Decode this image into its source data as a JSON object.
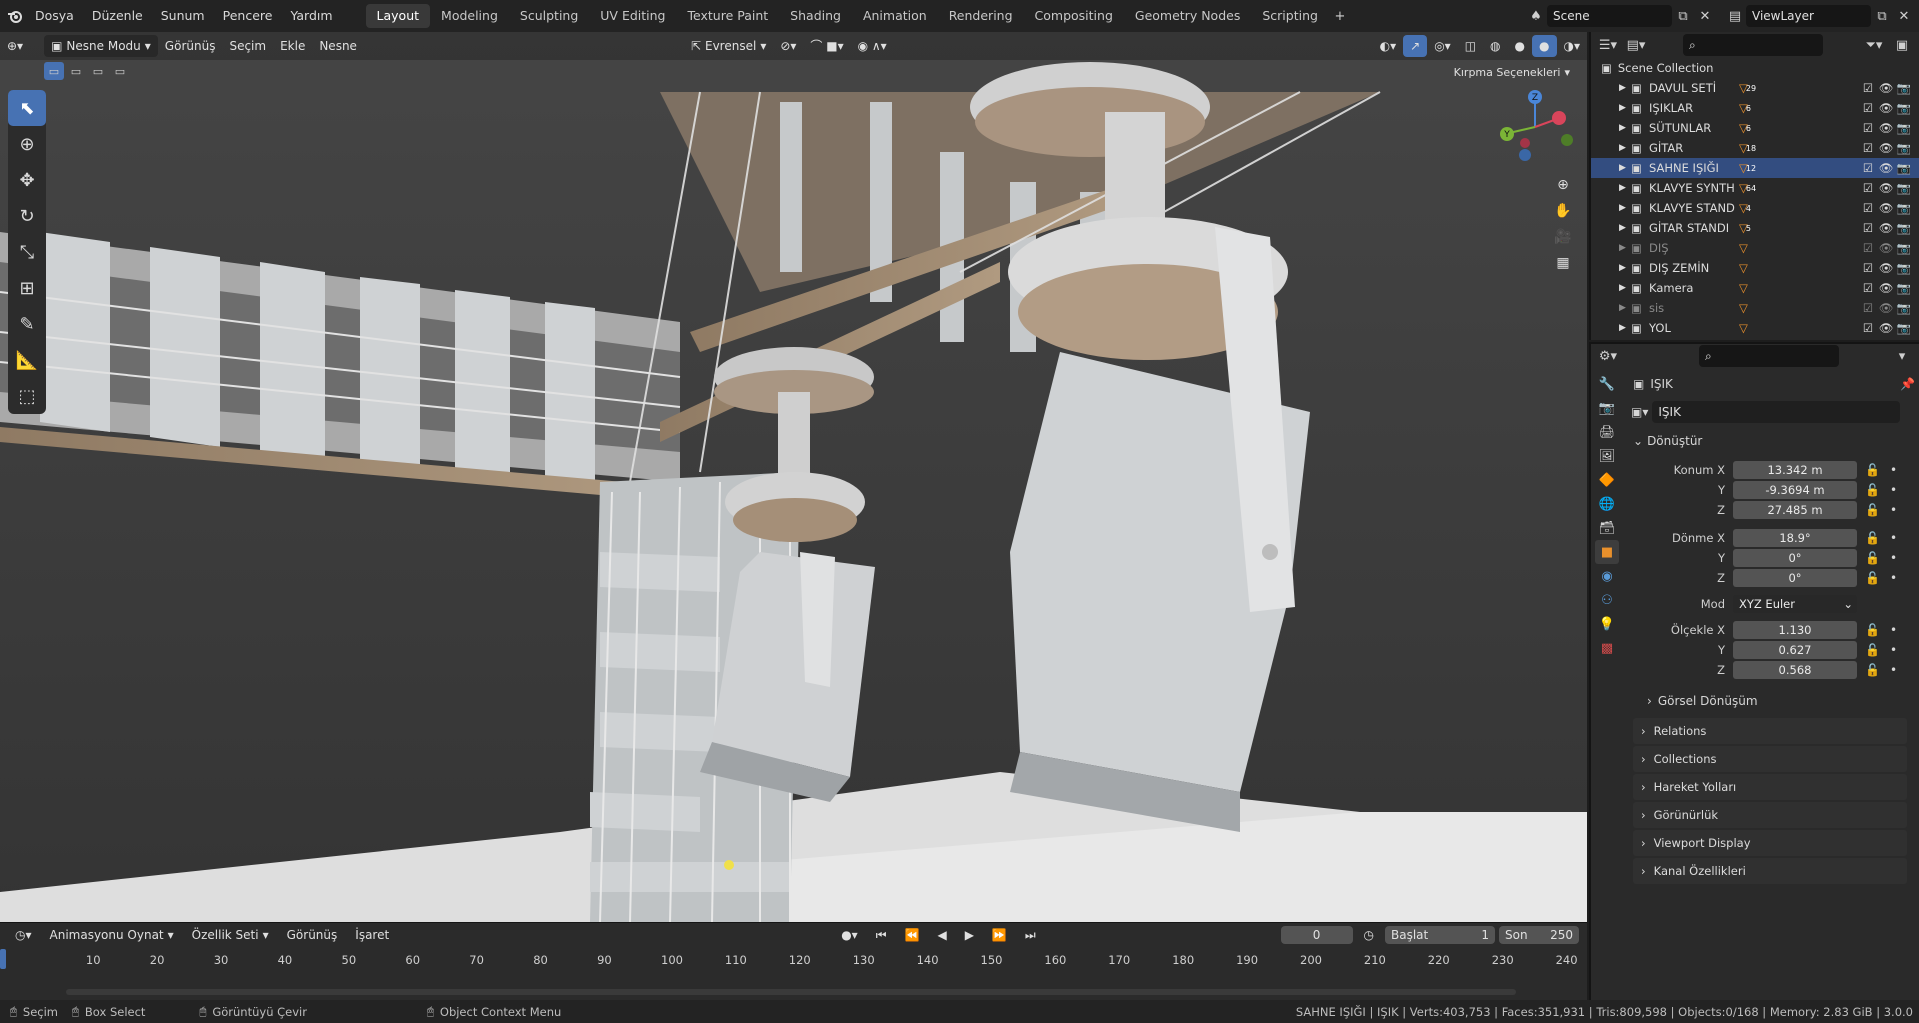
{
  "topbar": {
    "menus": [
      "Dosya",
      "Düzenle",
      "Sunum",
      "Pencere",
      "Yardım"
    ],
    "workspaces": [
      "Layout",
      "Modeling",
      "Sculpting",
      "UV Editing",
      "Texture Paint",
      "Shading",
      "Animation",
      "Rendering",
      "Compositing",
      "Geometry Nodes",
      "Scripting"
    ],
    "active_workspace": "Layout",
    "scene": "Scene",
    "view_layer": "ViewLayer"
  },
  "viewport": {
    "mode": "Nesne Modu",
    "menus": [
      "Görünüş",
      "Seçim",
      "Ekle",
      "Nesne"
    ],
    "transform_orientation": "Evrensel",
    "options_label": "Kırpma Seçenekleri"
  },
  "outliner": {
    "root": "Scene Collection",
    "items": [
      {
        "label": "DAVUL SETİ",
        "badge": "29",
        "dim": false,
        "selected": false
      },
      {
        "label": "IŞIKLAR",
        "badge": "6",
        "dim": false,
        "selected": false
      },
      {
        "label": "SÜTUNLAR",
        "badge": "6",
        "dim": false,
        "selected": false
      },
      {
        "label": "GİTAR",
        "badge": "18",
        "dim": false,
        "selected": false
      },
      {
        "label": "SAHNE IŞIĞI",
        "badge": "12",
        "dim": false,
        "selected": true
      },
      {
        "label": "KLAVYE SYNTH",
        "badge": "64",
        "dim": false,
        "selected": false
      },
      {
        "label": "KLAVYE STAND",
        "badge": "4",
        "dim": false,
        "selected": false
      },
      {
        "label": "GİTAR STANDI",
        "badge": "5",
        "dim": false,
        "selected": false
      },
      {
        "label": "DIŞ",
        "badge": "",
        "dim": true,
        "selected": false
      },
      {
        "label": "DIŞ ZEMİN",
        "badge": "",
        "dim": false,
        "selected": false
      },
      {
        "label": "Kamera",
        "badge": "",
        "dim": false,
        "selected": false
      },
      {
        "label": "sis",
        "badge": "",
        "dim": true,
        "selected": false
      },
      {
        "label": "YOL",
        "badge": "",
        "dim": false,
        "selected": false
      }
    ]
  },
  "properties": {
    "object_name": "IŞIK",
    "object_field": "IŞIK",
    "transform_title": "Dönüştür",
    "location_label": "Konum X",
    "location": [
      "13.342 m",
      "-9.3694 m",
      "27.485 m"
    ],
    "rotation_label": "Dönme X",
    "rotation": [
      "18.9°",
      "0°",
      "0°"
    ],
    "mode_label": "Mod",
    "mode_value": "XYZ Euler",
    "scale_label": "Ölçekle X",
    "scale": [
      "1.130",
      "0.627",
      "0.568"
    ],
    "y_label": "Y",
    "z_label": "Z",
    "delta_label": "Görsel Dönüşüm",
    "sections": [
      "Relations",
      "Collections",
      "Hareket Yolları",
      "Görünürlük",
      "Viewport Display",
      "Kanal Özellikleri"
    ]
  },
  "timeline": {
    "playback": "Animasyonu Oynat",
    "keying": "Özellik Seti",
    "view": "Görünüş",
    "marker": "İşaret",
    "current_frame": "0",
    "start_label": "Başlat",
    "start": "1",
    "end_label": "Son",
    "end": "250",
    "ticks": [
      "10",
      "20",
      "30",
      "40",
      "50",
      "60",
      "70",
      "80",
      "90",
      "100",
      "110",
      "120",
      "130",
      "140",
      "150",
      "160",
      "170",
      "180",
      "190",
      "200",
      "210",
      "220",
      "230",
      "240"
    ]
  },
  "statusbar": {
    "select": "Seçim",
    "box_select": "Box Select",
    "rotate_view": "Görüntüyü Çevir",
    "context_menu": "Object Context Menu",
    "stats": "SAHNE IŞIĞI | IŞIK | Verts:403,753 | Faces:351,931 | Tris:809,598 | Objects:0/168 | Memory: 2.83 GiB | 3.0.0"
  },
  "colors": {
    "accent": "#4772b3",
    "selected_row": "#334d80",
    "viewport_bg": "#3d3d3d",
    "floor": "#e1e1e1"
  }
}
